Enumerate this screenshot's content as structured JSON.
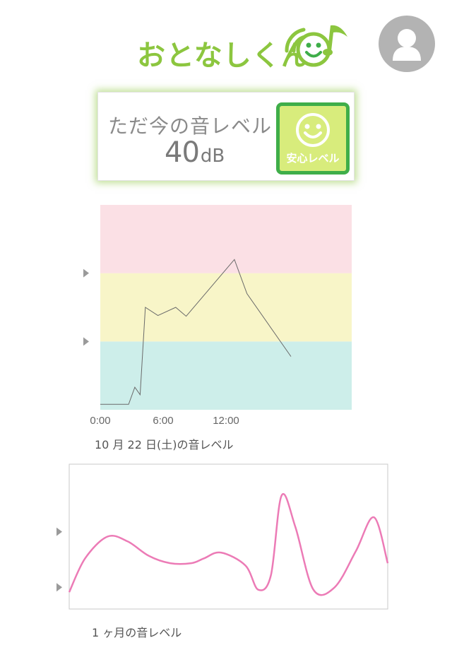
{
  "header": {
    "logo_text": "おとなしくん",
    "colors": {
      "brand_green": "#8cc63f",
      "mascot_green": "#3fae49"
    },
    "avatar_icon": "user-avatar-icon"
  },
  "current_level": {
    "label": "ただ今の音レベル",
    "value": "40",
    "unit": "dB",
    "status_label": "安心レベル",
    "status_icon": "smiley-face-icon",
    "colors": {
      "badge_fill": "#d8ec7c",
      "badge_border": "#3fae49",
      "card_glow": "#8cc63f"
    }
  },
  "chart_data": [
    {
      "type": "line",
      "caption": "10 月 22 日(土)の音レベル",
      "x_tick_labels": [
        "0:00",
        "6:00",
        "12:00"
      ],
      "xlim": [
        0,
        24
      ],
      "ylim": [
        0,
        3
      ],
      "level_bands": [
        {
          "from": 0,
          "to": 1,
          "color": "#cdeeea"
        },
        {
          "from": 1,
          "to": 2,
          "color": "#f8f5c8"
        },
        {
          "from": 2,
          "to": 3,
          "color": "#fbe0e5"
        }
      ],
      "threshold_markers": [
        1,
        2
      ],
      "line_color": "#6a6a6a",
      "series": [
        {
          "x": [
            0,
            2.7,
            3.3,
            3.8,
            4.3,
            5.5,
            7.2,
            8.2,
            12.8,
            14.0,
            18.2
          ],
          "values": [
            0.08,
            0.08,
            0.33,
            0.22,
            1.5,
            1.38,
            1.5,
            1.37,
            2.2,
            1.7,
            0.78
          ]
        }
      ]
    },
    {
      "type": "line",
      "caption": "1 ヶ月の音レベル",
      "xlim": [
        0,
        30
      ],
      "ylim": [
        0,
        3
      ],
      "threshold_markers": [
        0.45,
        1.6
      ],
      "line_color": "#ec7bb6",
      "series": [
        {
          "x": [
            0,
            1.5,
            3.6,
            5.5,
            7.5,
            9.5,
            11.5,
            12.7,
            14.3,
            16.6,
            17.8,
            19.0,
            20.0,
            21.3,
            23.0,
            25.0,
            27.0,
            28.7,
            30.0
          ],
          "values": [
            0.35,
            1.05,
            1.5,
            1.4,
            1.1,
            0.95,
            0.95,
            1.05,
            1.17,
            0.9,
            0.4,
            0.7,
            2.35,
            1.7,
            0.4,
            0.45,
            1.2,
            1.9,
            0.95
          ]
        }
      ]
    }
  ]
}
